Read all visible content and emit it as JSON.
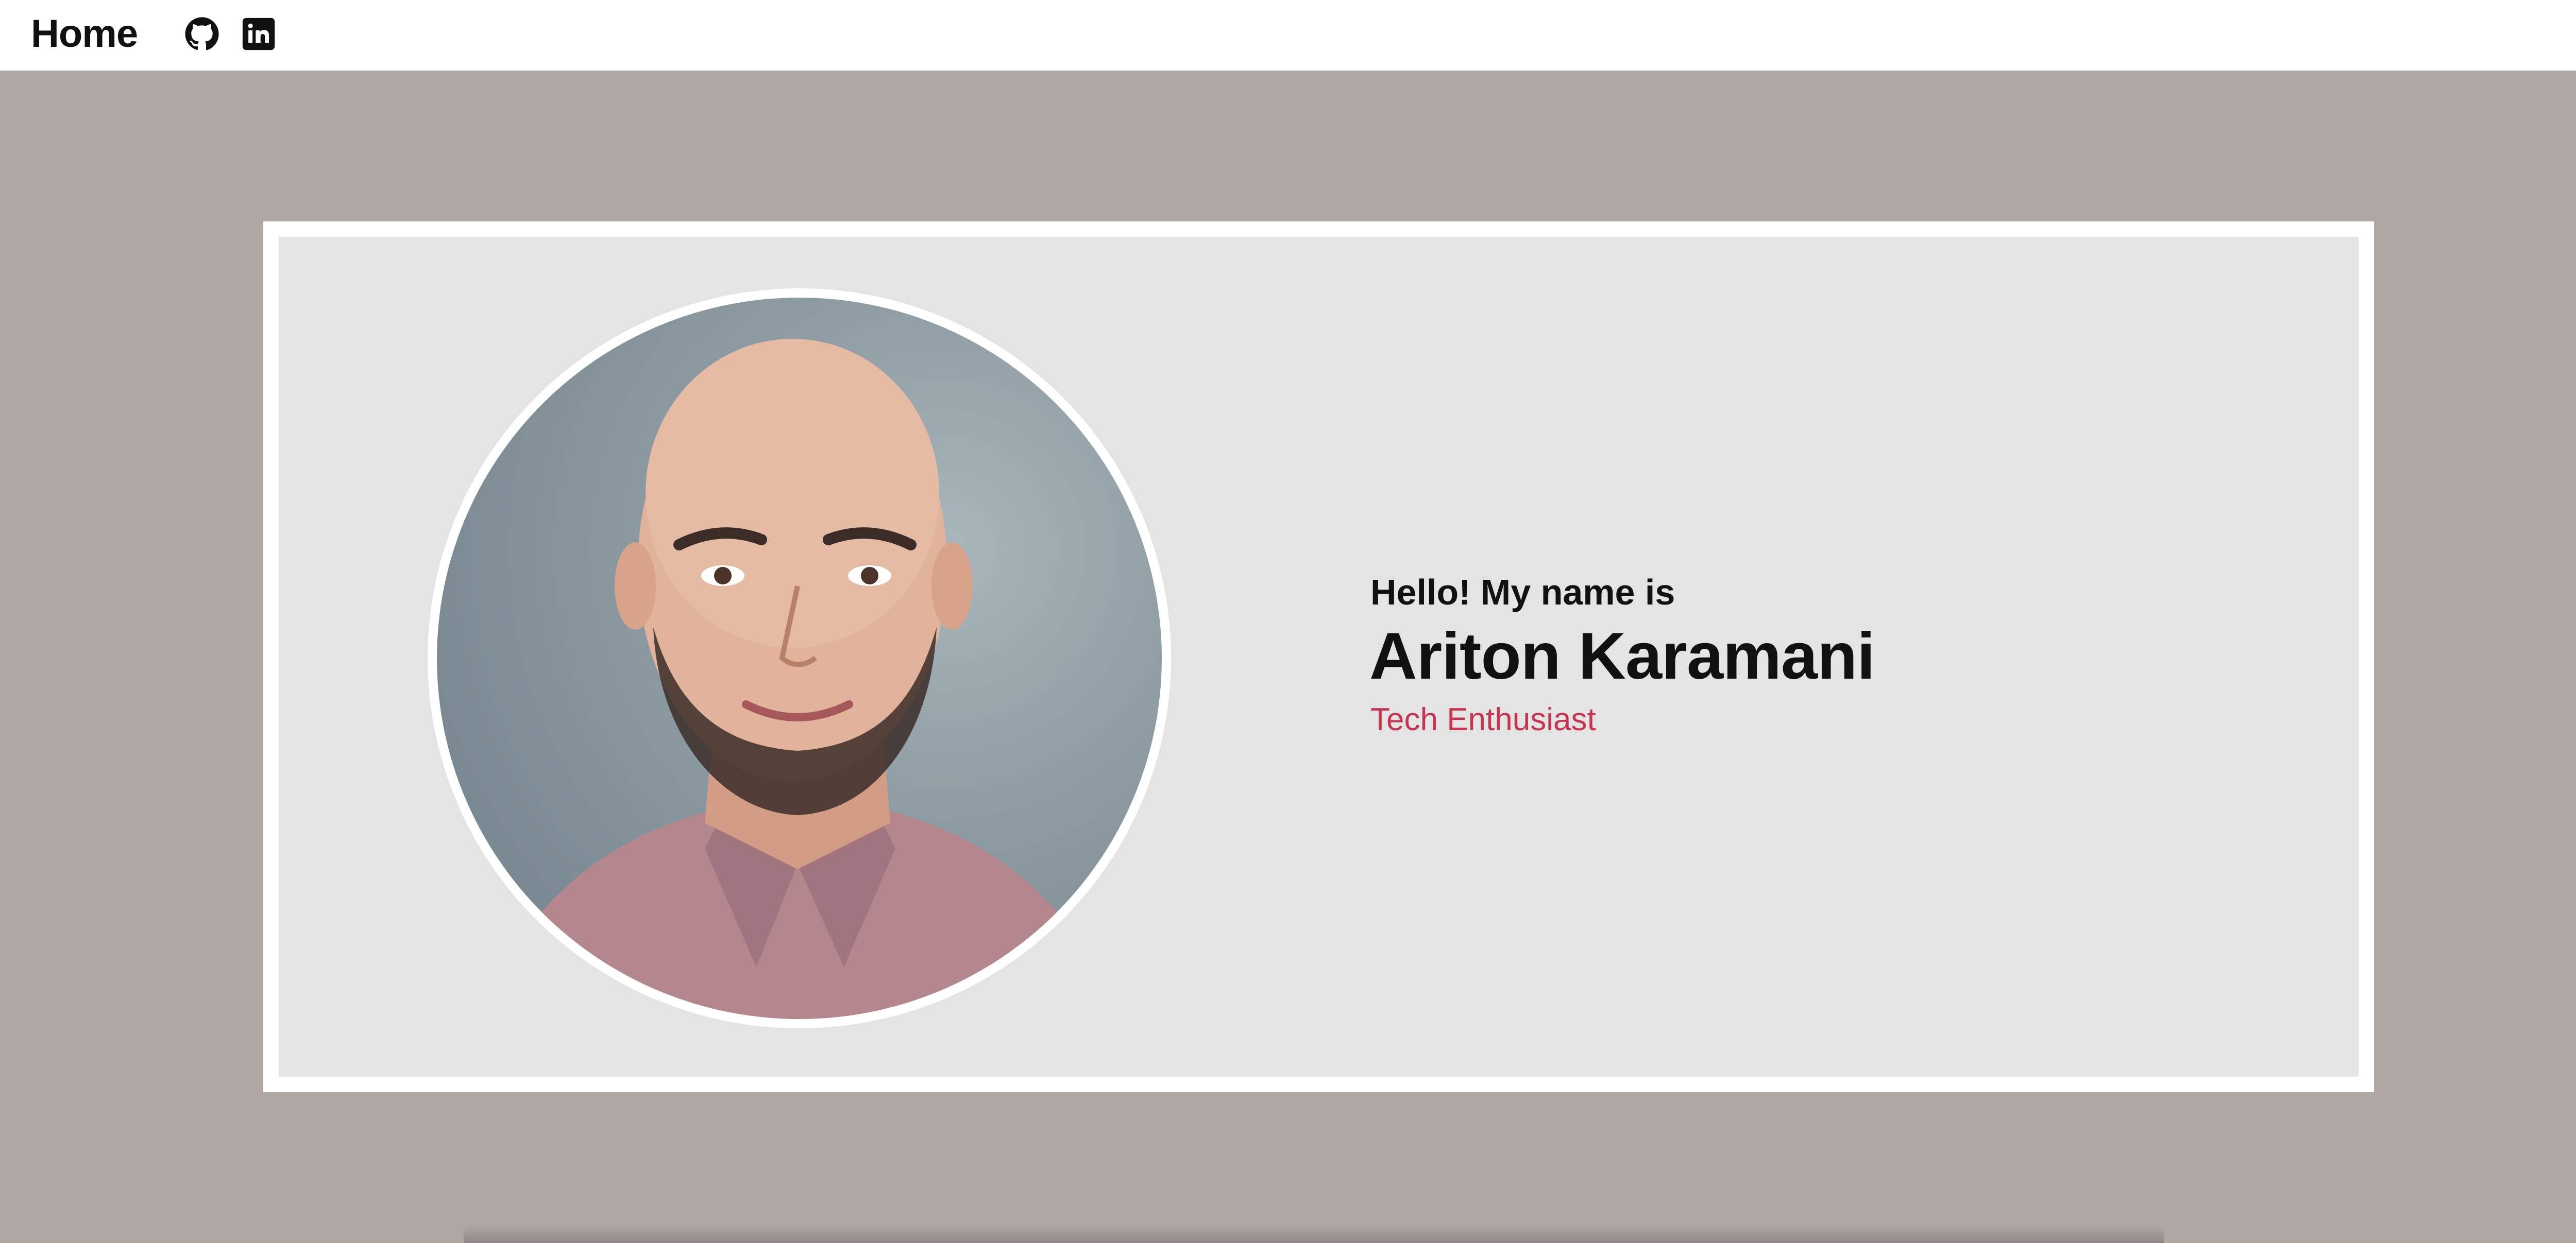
{
  "nav": {
    "home_label": "Home",
    "github_icon": "github-icon",
    "linkedin_icon": "linkedin-icon",
    "menu_icon": "hamburger-menu-icon"
  },
  "hero": {
    "greeting": "Hello! My name is",
    "name": "Ariton Karamani",
    "role": "Tech Enthusiast",
    "portrait_alt": "portrait photo"
  },
  "colors": {
    "page_background": "#afa6a4",
    "card_frame": "#ffffff",
    "card_inner": "#e4e4e4",
    "accent_role": "#c8334f",
    "text": "#111111"
  }
}
